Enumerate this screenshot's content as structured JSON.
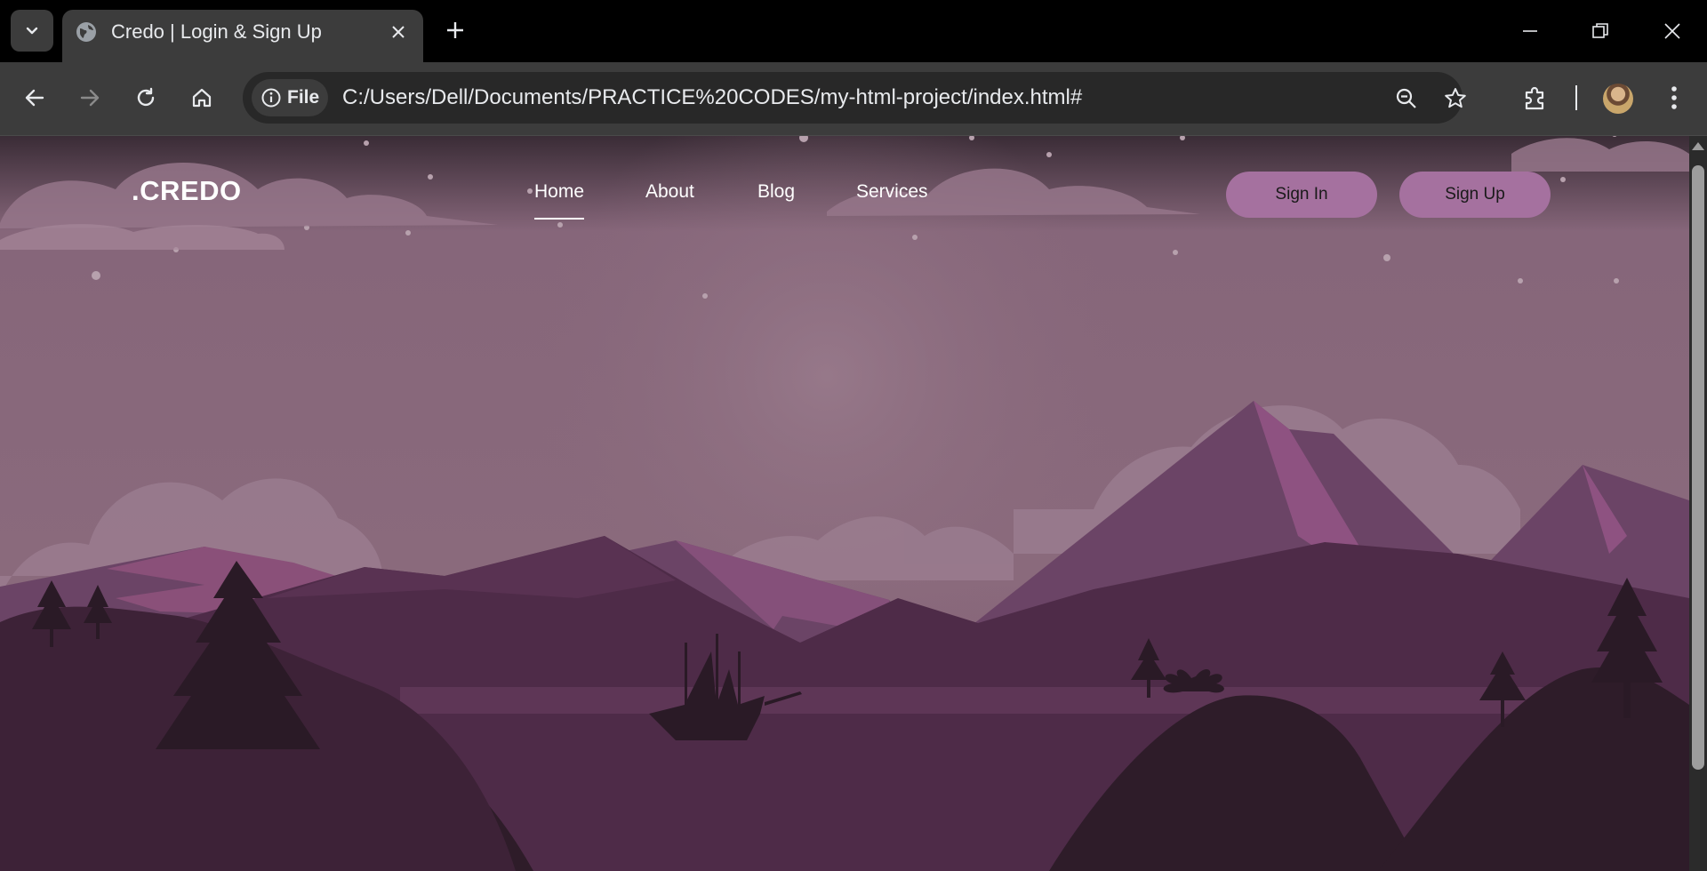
{
  "browser": {
    "tab": {
      "title": "Credo | Login & Sign Up"
    },
    "address_bar": {
      "chip_label": "File",
      "url": "C:/Users/Dell/Documents/PRACTICE%20CODES/my-html-project/index.html#"
    }
  },
  "page": {
    "logo": ".CREDO",
    "nav": {
      "home": "Home",
      "about": "About",
      "blog": "Blog",
      "services": "Services",
      "active": "Home"
    },
    "buttons": {
      "sign_in": "Sign In",
      "sign_up": "Sign Up"
    }
  },
  "colors": {
    "sky": "#876577",
    "pill": "#a5719f",
    "mountain_far": "#6b4466",
    "mountain_near": "#4a2744",
    "trees": "#2e1c29"
  }
}
